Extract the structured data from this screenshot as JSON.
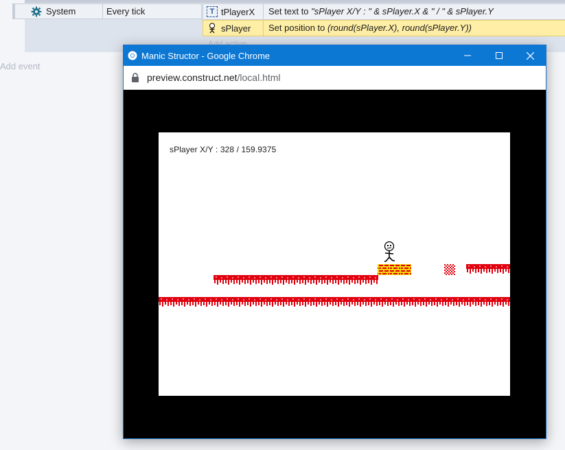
{
  "event_sheet": {
    "condition": {
      "object": "System",
      "text": "Every tick",
      "icon": "gear-icon"
    },
    "actions": [
      {
        "object": "tPlayerX",
        "icon": "text-object-icon",
        "text_prefix": "Set text to ",
        "text_expr": "\"sPlayer X/Y  : \" & sPlayer.X & \" / \" & sPlayer.Y"
      },
      {
        "object": "sPlayer",
        "icon": "sprite-player-icon",
        "text_prefix": "Set position to ",
        "text_expr": "(round(sPlayer.X), round(sPlayer.Y))"
      }
    ],
    "add_action": "Add action",
    "add_event": "Add event"
  },
  "browser": {
    "title": "Manic Structor - Google Chrome",
    "url_host": "preview.construct.net",
    "url_path": "/local.html",
    "minimize_symbol": "—",
    "maximize_symbol": "☐",
    "close_symbol": "✕"
  },
  "game": {
    "hud_text": "sPlayer X/Y  : 328 / 159.9375"
  },
  "colors": {
    "titlebar": "#0d78d4",
    "platform_red": "#e0000e",
    "brick_yellow": "#f5d90b",
    "selected_row": "#ffeea5"
  }
}
